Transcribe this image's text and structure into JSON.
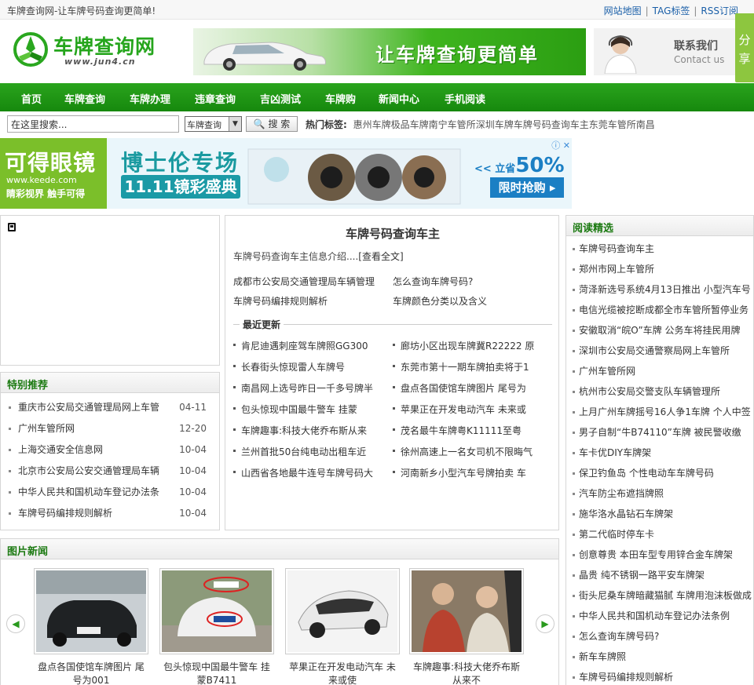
{
  "topbar": {
    "welcome": "车牌查询网-让车牌号码查询更简单!",
    "links": [
      "网站地图",
      "TAG标签",
      "RSS订阅"
    ],
    "sep": "|"
  },
  "logo": {
    "name": "车牌查询网",
    "url": "www.jun4.cn"
  },
  "banner": {
    "slogan": "让车牌查询更简单"
  },
  "contact": {
    "cn": "联系我们",
    "en": "Contact us"
  },
  "share": {
    "label": "分享"
  },
  "nav": [
    "首页",
    "车牌查询",
    "车牌办理",
    "违章查询",
    "吉凶测试",
    "车牌购",
    "新闻中心",
    "手机阅读"
  ],
  "search": {
    "value": "在这里搜索...",
    "select": "车牌查询",
    "button": "搜 索",
    "hot_label": "热门标签:",
    "hot_tags": [
      "惠州车牌",
      "极品车牌",
      "南宁车管所",
      "深圳车牌",
      "车牌号码查询车主",
      "东莞车管所",
      "南昌"
    ]
  },
  "ad": {
    "brand": "可得眼镜",
    "brand_url": "www.keede.com",
    "brand_tag": "睛彩视界 触手可得",
    "headline": "博士伦专场",
    "subline": "11.11镜彩盛典",
    "save": "<< 立省",
    "save_pct": "50%",
    "buy": "限时抢购 ▸",
    "icons": "ⓘ ✕"
  },
  "recommend": {
    "title": "特别推荐",
    "items": [
      {
        "text": "重庆市公安局交通管理局网上车管",
        "date": "04-11"
      },
      {
        "text": "广州车管所网",
        "date": "12-20"
      },
      {
        "text": "上海交通安全信息网",
        "date": "10-04"
      },
      {
        "text": "北京市公安局公安交通管理局车辆",
        "date": "10-04"
      },
      {
        "text": "中华人民共和国机动车登记办法条",
        "date": "10-04"
      },
      {
        "text": "车牌号码编排规则解析",
        "date": "10-04"
      }
    ]
  },
  "center": {
    "title": "车牌号码查询车主",
    "intro": "车牌号码查询车主信息介绍....",
    "intro_more": "[查看全文]",
    "links": [
      "成都市公安局交通管理局车辆管理",
      "怎么查询车牌号码?",
      "车牌号码编排规则解析",
      "车牌颜色分类以及含义"
    ],
    "recent_label": "最近更新",
    "recent": [
      "肯尼迪遇刺座驾车牌照GG300",
      "廊坊小区出现车牌冀R22222 原",
      "长春街头惊现雷人车牌号",
      "东莞市第十一期车牌拍卖将于1",
      "南昌网上选号昨日一千多号牌半",
      "盘点各国使馆车牌图片 尾号为",
      "包头惊现中国最牛警车 挂蒙",
      "苹果正在开发电动汽车 未来或",
      "车牌趣事:科技大佬乔布斯从来",
      "茂名最牛车牌粤K11111至粤",
      "兰州首批50台纯电动出租车近",
      "徐州高速上一名女司机不限晦气",
      "山西省各地最牛连号车牌号码大",
      "河南新乡小型汽车号牌拍卖 车"
    ]
  },
  "reading": {
    "title": "阅读精选",
    "items": [
      "车牌号码查询车主",
      "郑州市网上车管所",
      "菏泽新选号系统4月13日推出 小型汽车号",
      "电信光缆被挖断成都全市车管所暂停业务",
      "安徽取消“皖O”车牌 公务车将挂民用牌",
      "深圳市公安局交通警察局网上车管所",
      "广州车管所网",
      "杭州市公安局交警支队车辆管理所",
      "上月广州车牌摇号16人争1车牌 个人中签",
      "男子自制“牛B74110”车牌 被民警收缴",
      "车卡优DIY车牌架",
      "保卫钓鱼岛 个性电动车车牌号码",
      "汽车防尘布遮挡牌照",
      "施华洛水晶钻石车牌架",
      "第二代临时停车卡",
      "创意尊贵 本田车型专用锌合金车牌架",
      "晶贵 纯不锈钢一路平安车牌架",
      "街头尼桑车牌暗藏猫腻 车牌用泡沫板做成",
      "中华人民共和国机动车登记办法条例",
      "怎么查询车牌号码?",
      "新车车牌照",
      "车牌号码编排规则解析"
    ]
  },
  "photos": {
    "title": "图片新闻",
    "prev": "◀",
    "next": "▶",
    "items": [
      {
        "caption": "盘点各国使馆车牌图片 尾号为001"
      },
      {
        "caption": "包头惊现中国最牛警车 挂蒙B7411"
      },
      {
        "caption": "苹果正在开发电动汽车 未来或使"
      },
      {
        "caption": "车牌趣事:科技大佬乔布斯从来不"
      }
    ]
  }
}
